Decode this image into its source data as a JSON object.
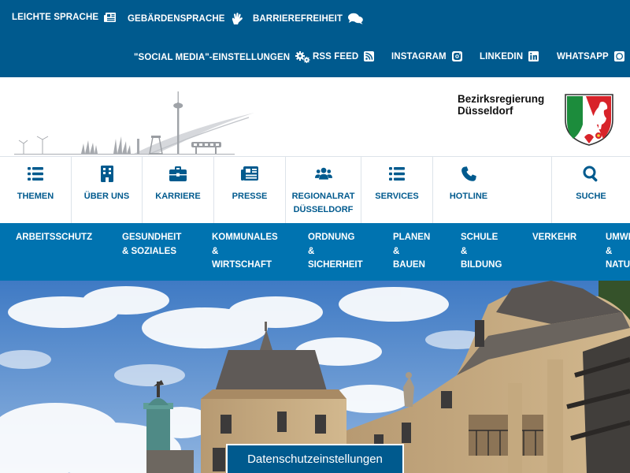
{
  "utility": {
    "leichte_sprache": "Leichte Sprache",
    "gebaerdensprache": "Gebärdensprache",
    "barrierefreiheit": "Barrierefreiheit",
    "social_media": "\"Social Media\"-Einstellungen",
    "rss": "RSS Feed",
    "instagram": "Instagram",
    "linkedin": "LinkedIn",
    "whatsapp": "WhatsApp"
  },
  "header": {
    "org_line1": "Bezirksregierung",
    "org_line2": "Düsseldorf"
  },
  "nav": {
    "themen": "Themen",
    "ueber_uns": "Über uns",
    "karriere": "Karriere",
    "presse": "Presse",
    "regionalrat": "Regionalrat\nDüsseldorf",
    "services": "Services",
    "hotline": "Hotline",
    "suche": "Suche"
  },
  "topics": {
    "arbeitsschutz": "Arbeitsschutz",
    "gesundheit": "Gesundheit\n& Soziales",
    "kommunales": "Kommunales\n&\nWirtschaft",
    "ordnung": "Ordnung\n&\nSicherheit",
    "planen": "Planen\n&\nBauen",
    "schule": "Schule\n&\nBildung",
    "verkehr": "Verkehr",
    "umwelt": "Umwelt\n&\nNatur"
  },
  "privacy_button": "Datenschutzeinstellungen",
  "icons": {
    "leichte_sprache": "newspaper-icon",
    "gebaerdensprache": "sign-language-icon",
    "barrierefreiheit": "comments-icon",
    "social_media": "gears-icon",
    "rss": "rss-icon",
    "instagram": "instagram-icon",
    "linkedin": "linkedin-icon",
    "whatsapp": "whatsapp-icon",
    "themen": "list-icon",
    "ueber_uns": "building-icon",
    "karriere": "briefcase-icon",
    "presse": "newspaper-icon",
    "regionalrat": "users-icon",
    "services": "list-icon",
    "hotline": "phone-icon",
    "suche": "search-icon"
  },
  "colors": {
    "topbar": "#005a8e",
    "topicbar": "#0073b0",
    "accent": "#005a8e"
  }
}
